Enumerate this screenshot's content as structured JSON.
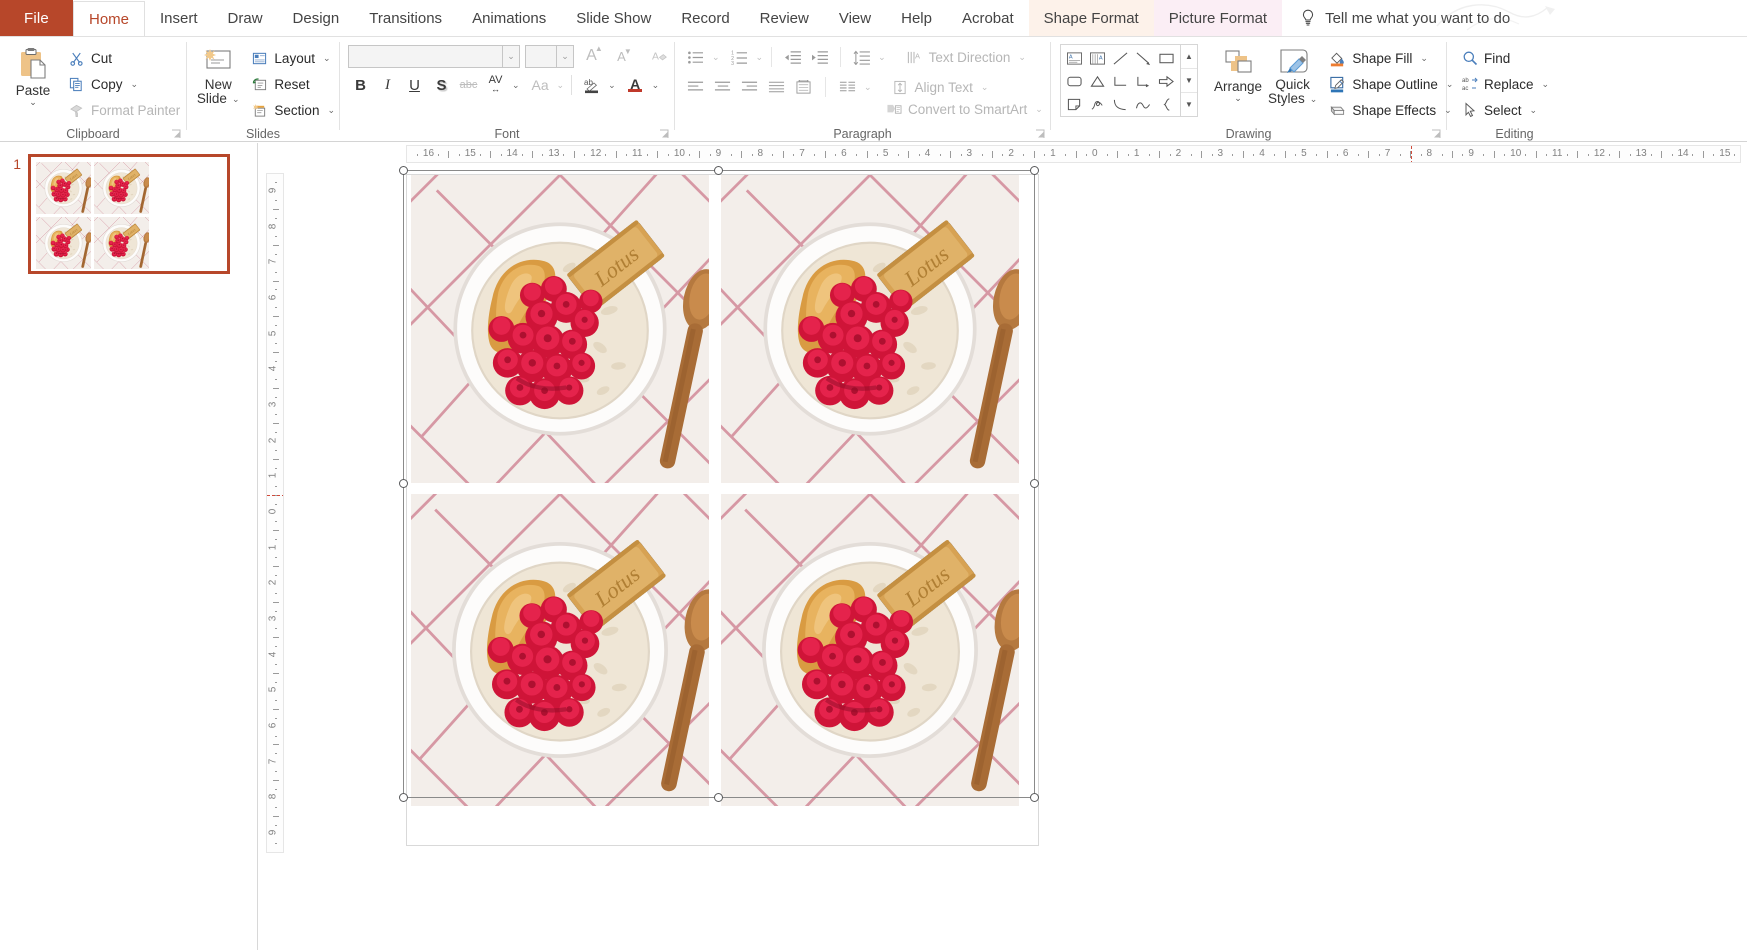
{
  "app": {
    "title": "PowerPoint",
    "file_tab": "File"
  },
  "tabs": [
    {
      "label": "Home",
      "state": "active"
    },
    {
      "label": "Insert",
      "state": "normal"
    },
    {
      "label": "Draw",
      "state": "normal"
    },
    {
      "label": "Design",
      "state": "normal"
    },
    {
      "label": "Transitions",
      "state": "normal"
    },
    {
      "label": "Animations",
      "state": "normal"
    },
    {
      "label": "Slide Show",
      "state": "normal"
    },
    {
      "label": "Record",
      "state": "normal"
    },
    {
      "label": "Review",
      "state": "normal"
    },
    {
      "label": "View",
      "state": "normal"
    },
    {
      "label": "Help",
      "state": "normal"
    },
    {
      "label": "Acrobat",
      "state": "normal"
    },
    {
      "label": "Shape Format",
      "state": "contextual-shape"
    },
    {
      "label": "Picture Format",
      "state": "contextual-picture"
    }
  ],
  "tellme": {
    "label": "Tell me what you want to do",
    "icon": "lightbulb-icon"
  },
  "ribbon": {
    "groups": [
      {
        "name": "Clipboard",
        "label": "Clipboard"
      },
      {
        "name": "Slides",
        "label": "Slides"
      },
      {
        "name": "Font",
        "label": "Font"
      },
      {
        "name": "Paragraph",
        "label": "Paragraph"
      },
      {
        "name": "Drawing",
        "label": "Drawing"
      },
      {
        "name": "Editing",
        "label": "Editing"
      }
    ],
    "clipboard": {
      "paste": "Paste",
      "cut": "Cut",
      "copy": "Copy",
      "format_painter": "Format Painter",
      "format_painter_disabled": true
    },
    "slides": {
      "new_slide_line1": "New",
      "new_slide_line2": "Slide",
      "layout": "Layout",
      "reset": "Reset",
      "section": "Section"
    },
    "font": {
      "font_name_value": "",
      "font_name_placeholder": "",
      "font_size_value": "",
      "bold": "B",
      "italic": "I",
      "underline": "U",
      "shadow": "S",
      "strikethrough": "abc",
      "character_spacing": "AV",
      "change_case": "Aa",
      "text_highlight": "ab",
      "font_color": "A",
      "increase_font": "A",
      "decrease_font": "A",
      "clear_formatting": "A"
    },
    "paragraph": {
      "text_direction": "Text Direction",
      "align_text": "Align Text",
      "convert_to_smartart": "Convert to SmartArt"
    },
    "drawing": {
      "arrange": "Arrange",
      "quick_styles_line1": "Quick",
      "quick_styles_line2": "Styles",
      "shape_fill": "Shape Fill",
      "shape_outline": "Shape Outline",
      "shape_effects": "Shape Effects",
      "shapes": [
        "textbox-shape",
        "vertical-textbox-shape",
        "line-shape",
        "arrow-shape",
        "rectangle-shape",
        "oval-shape",
        "rounded-rectangle-shape",
        "isosceles-triangle-shape",
        "elbow-connector-shape",
        "elbow-arrow-connector-shape",
        "right-arrow-shape",
        "down-arrow-shape",
        "folded-corner-shape",
        "scribble-shape",
        "curve-shape",
        "arc-shape",
        "left-brace-shape",
        "right-brace-shape"
      ],
      "shape_fill_color": "#ED7D31",
      "shape_outline_color": "#2E75B6"
    },
    "editing": {
      "find": "Find",
      "replace": "Replace",
      "select": "Select"
    }
  },
  "slides_panel": {
    "slides": [
      {
        "number": "1",
        "selected": true,
        "image_count": 4
      }
    ]
  },
  "rulers": {
    "horizontal_ticks": [
      "16",
      "15",
      "14",
      "13",
      "12",
      "11",
      "10",
      "9",
      "8",
      "7",
      "6",
      "5",
      "4",
      "3",
      "2",
      "1",
      "0",
      "1",
      "2",
      "3",
      "4",
      "5",
      "6",
      "7",
      "8",
      "9",
      "10",
      "11",
      "12",
      "13",
      "14",
      "15",
      "16"
    ],
    "horizontal_zero_index": 16,
    "horizontal_marker_after": "6",
    "vertical_ticks": [
      "9",
      "8",
      "7",
      "6",
      "5",
      "4",
      "3",
      "2",
      "1",
      "0",
      "1",
      "2",
      "3",
      "4",
      "5",
      "6",
      "7",
      "8",
      "9"
    ],
    "vertical_zero_index": 9,
    "vertical_marker_before_index": 8,
    "units": "inches",
    "marker_color": "#d04a3a"
  },
  "slide": {
    "selection": {
      "active": true,
      "handle_count": 8,
      "border_color": "#8a8a8a",
      "handle_fill": "#ffffff",
      "handle_stroke": "#58595b"
    },
    "pictures": [
      {
        "id": "picture-1",
        "alt": "Bowl of oatmeal with raspberries, peanut butter and a Lotus biscuit"
      },
      {
        "id": "picture-2",
        "alt": "Bowl of oatmeal with raspberries, peanut butter and a Lotus biscuit"
      },
      {
        "id": "picture-3",
        "alt": "Bowl of oatmeal with raspberries, peanut butter and a Lotus biscuit"
      },
      {
        "id": "picture-4",
        "alt": "Bowl of oatmeal with raspberries, peanut butter and a Lotus biscuit"
      }
    ],
    "picture_label": "Lotus"
  },
  "colors": {
    "accent": "#b7472a",
    "ribbon_bg": "#ffffff",
    "contextual_shape_bg": "#fdf2ea",
    "contextual_picture_bg": "#fbeef5"
  }
}
